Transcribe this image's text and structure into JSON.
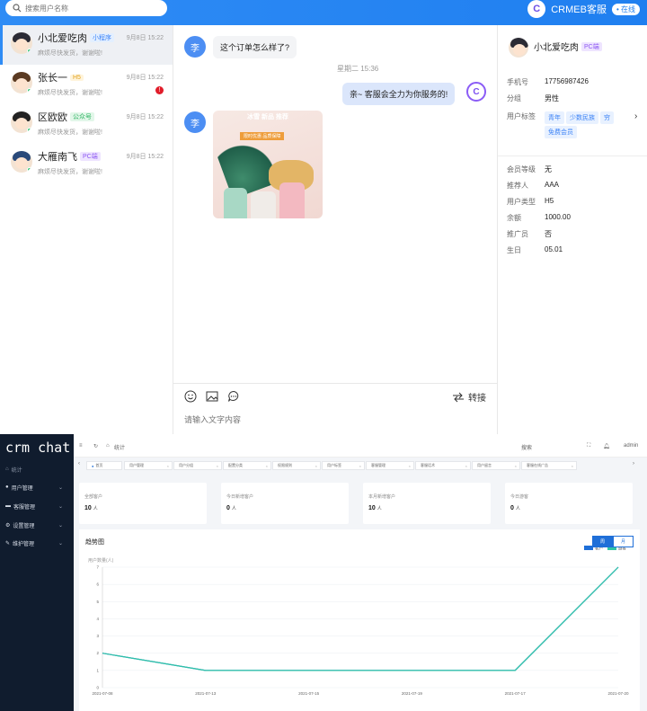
{
  "chat_app": {
    "search_placeholder": "搜索用户名称",
    "brand": "CRMEB客服",
    "status": "• 在线",
    "contacts": [
      {
        "name": "小北爱吃肉",
        "tag": "小程序",
        "message": "麻烦尽快发货，谢谢啦!",
        "time": "9月8日 15:22"
      },
      {
        "name": "张长一",
        "tag": "H5",
        "message": "麻烦尽快发货，谢谢啦!",
        "time": "9月8日 15:22",
        "badge": "!"
      },
      {
        "name": "区欧欧",
        "tag": "公众号",
        "message": "麻烦尽快发货，谢谢啦!",
        "time": "9月8日 15:22"
      },
      {
        "name": "大雁南飞",
        "tag": "PC端",
        "message": "麻烦尽快发货，谢谢啦!",
        "time": "9月8日 15:22"
      }
    ],
    "messages": {
      "user_avatar": "李",
      "m1": "这个订单怎么样了?",
      "timestamp": "星期二 15:36",
      "m2": "亲~ 客服会全力为你服务的!",
      "kefu_avatar": "C",
      "image_text": "冰雪 新品 推荐",
      "image_banner": "限时优惠 品质保障"
    },
    "toolbar": {
      "transfer": "转接",
      "input_placeholder": "请输入文字内容"
    },
    "profile": {
      "name": "小北爱吃肉",
      "tag": "PC端",
      "phone_label": "手机号",
      "phone": "17756987426",
      "group_label": "分组",
      "group": "男性",
      "tags_label": "用户标签",
      "tags": [
        "青年",
        "少数民族",
        "穷",
        "免费会员"
      ],
      "level_label": "会员等级",
      "level": "无",
      "referrer_label": "推荐人",
      "referrer": "AAA",
      "type_label": "用户类型",
      "type": "H5",
      "balance_label": "余额",
      "balance": "1000.00",
      "promoter_label": "推广员",
      "promoter": "否",
      "birthday_label": "生日",
      "birthday": "05.01"
    }
  },
  "crm": {
    "logo": "crm chat",
    "sidebar": {
      "home": "统计",
      "items": [
        "用户管理",
        "客服管理",
        "设置管理",
        "维护管理"
      ]
    },
    "header": {
      "breadcrumb": "统计",
      "search": "搜索",
      "user": "admin"
    },
    "tabs": [
      "首页",
      "用户管理",
      "用户分组",
      "配置分类",
      "权限规则",
      "用户标签",
      "客服管理",
      "客服话术",
      "用户留言",
      "客服在线广告"
    ],
    "stats": [
      {
        "label": "全部客户",
        "value": "10",
        "unit": "人"
      },
      {
        "label": "今日新增客户",
        "value": "0",
        "unit": "人"
      },
      {
        "label": "本月新增客户",
        "value": "10",
        "unit": "人"
      },
      {
        "label": "今日游客",
        "value": "0",
        "unit": "人"
      }
    ],
    "trend_title": "趋势图",
    "toggle": [
      "周",
      "月"
    ]
  },
  "chart_data": {
    "type": "line",
    "title": "趋势图",
    "ylabel": "用户数量(人)",
    "x": [
      "2021-07-08",
      "2021-07-13",
      "2021-07-15",
      "2021-07-19",
      "2021-07-17",
      "2021-07-20"
    ],
    "series": [
      {
        "name": "客户",
        "color": "#1f6fd8",
        "values": [
          2,
          1,
          1,
          1,
          1,
          7
        ]
      },
      {
        "name": "游客",
        "color": "#2ec4a5",
        "values": [
          2,
          1,
          1,
          1,
          1,
          7
        ]
      }
    ],
    "ylim": [
      0,
      7
    ],
    "yticks": [
      0,
      1,
      2,
      3,
      4,
      5,
      6,
      7
    ],
    "legend": "top-right",
    "grid": true
  }
}
